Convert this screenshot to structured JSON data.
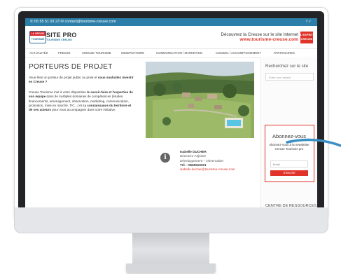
{
  "topbar": {
    "contact": "✆ 05 55 51 93 23   ✉ contact@tourisme-creuse.com",
    "social": "f  ✓"
  },
  "header": {
    "logo_line1": "LA CREUSE",
    "logo_line2": "TOURISME",
    "brand_title": "SITE PRO",
    "brand_sub": "TOURISME CREUSE",
    "promo_line1": "Découvrez la Creuse sur le site Internet",
    "promo_line2": "www.tourisme-creuse.com",
    "esprit_line1": "L'ESPRIT",
    "esprit_line2": "CREUSE"
  },
  "nav": {
    "items": [
      "ACTUALITÉS",
      "PRESSE",
      "CREUSE TOURISME",
      "OBSERVATOIRE",
      "COMMUNICATION / MARKETING",
      "CONSEIL / ACCOMPAGNEMENT",
      "PARTENAIRES"
    ]
  },
  "main": {
    "title": "PORTEURS DE PROJET",
    "intro_a": "Vous êtes un porteur de projet public ou privé et ",
    "intro_b": "vous souhaitez investir en Creuse ?",
    "body_a": "Creuse Tourisme met à votre disposition ",
    "body_b": "le savoir-faire et l'expertise de son équipe",
    "body_c": " dans de multiples domaines de compétences (études, financements, aménagement, observation, marketing, communication, promotion, mise en marché, TIC...) et sa ",
    "body_d": "connaissance du territoire et de ses acteurs",
    "body_e": " pour vous accompagner dans votre initiative."
  },
  "contact": {
    "icon_glyph": "i",
    "name": "Isabelle DUCHER",
    "role1": "Directrice Adjointe",
    "role2": "Développement – Observation",
    "phone": "Tél. : 0555519321",
    "email": "isabelle.ducher@tourisme-creuse.com"
  },
  "sidebar": {
    "search_title": "Recherchez sur le site",
    "search_placeholder": "Enter your search",
    "newsletter_title": "Abonnez-vous",
    "newsletter_text": "Abonnez-vous à la newsletter Creuse Tourisme pro",
    "email_placeholder": "Email",
    "subscribe_label": "S'inscrire",
    "ressources_title": "CENTRE DE RESSOURCES"
  },
  "colors": {
    "accent_blue": "#2c7fa8",
    "accent_red": "#e0342a",
    "curve_blue": "#3a8fc4"
  }
}
